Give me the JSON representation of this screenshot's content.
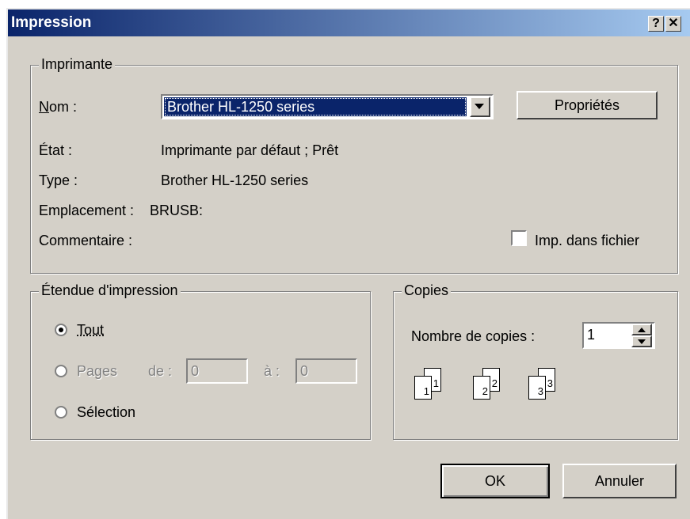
{
  "window": {
    "title": "Impression",
    "help_glyph": "?",
    "close_glyph": "✕"
  },
  "printer": {
    "group_label": "Imprimante",
    "name_label": "Nom :",
    "name_value": "Brother HL-1250 series",
    "properties_button": "Propriétés",
    "state_label": "État :",
    "state_value": "Imprimante par défaut ; Prêt",
    "type_label": "Type :",
    "type_value": "Brother HL-1250 series",
    "location_label": "Emplacement :",
    "location_value": "BRUSB:",
    "comment_label": "Commentaire :",
    "print_to_file_label": "Imp. dans fichier",
    "print_to_file_checked": false
  },
  "range": {
    "group_label": "Étendue d'impression",
    "all_label": "Tout",
    "pages_label": "Pages",
    "from_label": "de :",
    "from_value": "0",
    "to_label": "à :",
    "to_value": "0",
    "selection_label": "Sélection",
    "selected": "all"
  },
  "copies": {
    "group_label": "Copies",
    "count_label": "Nombre de copies :",
    "count_value": "1",
    "collate_pages": [
      "1",
      "1",
      "2",
      "2",
      "3",
      "3"
    ]
  },
  "buttons": {
    "ok": "OK",
    "cancel": "Annuler"
  },
  "colors": {
    "titlebar_start": "#0a246a",
    "titlebar_end": "#a6caf0",
    "selection": "#0a246a",
    "face": "#d4d0c8"
  }
}
